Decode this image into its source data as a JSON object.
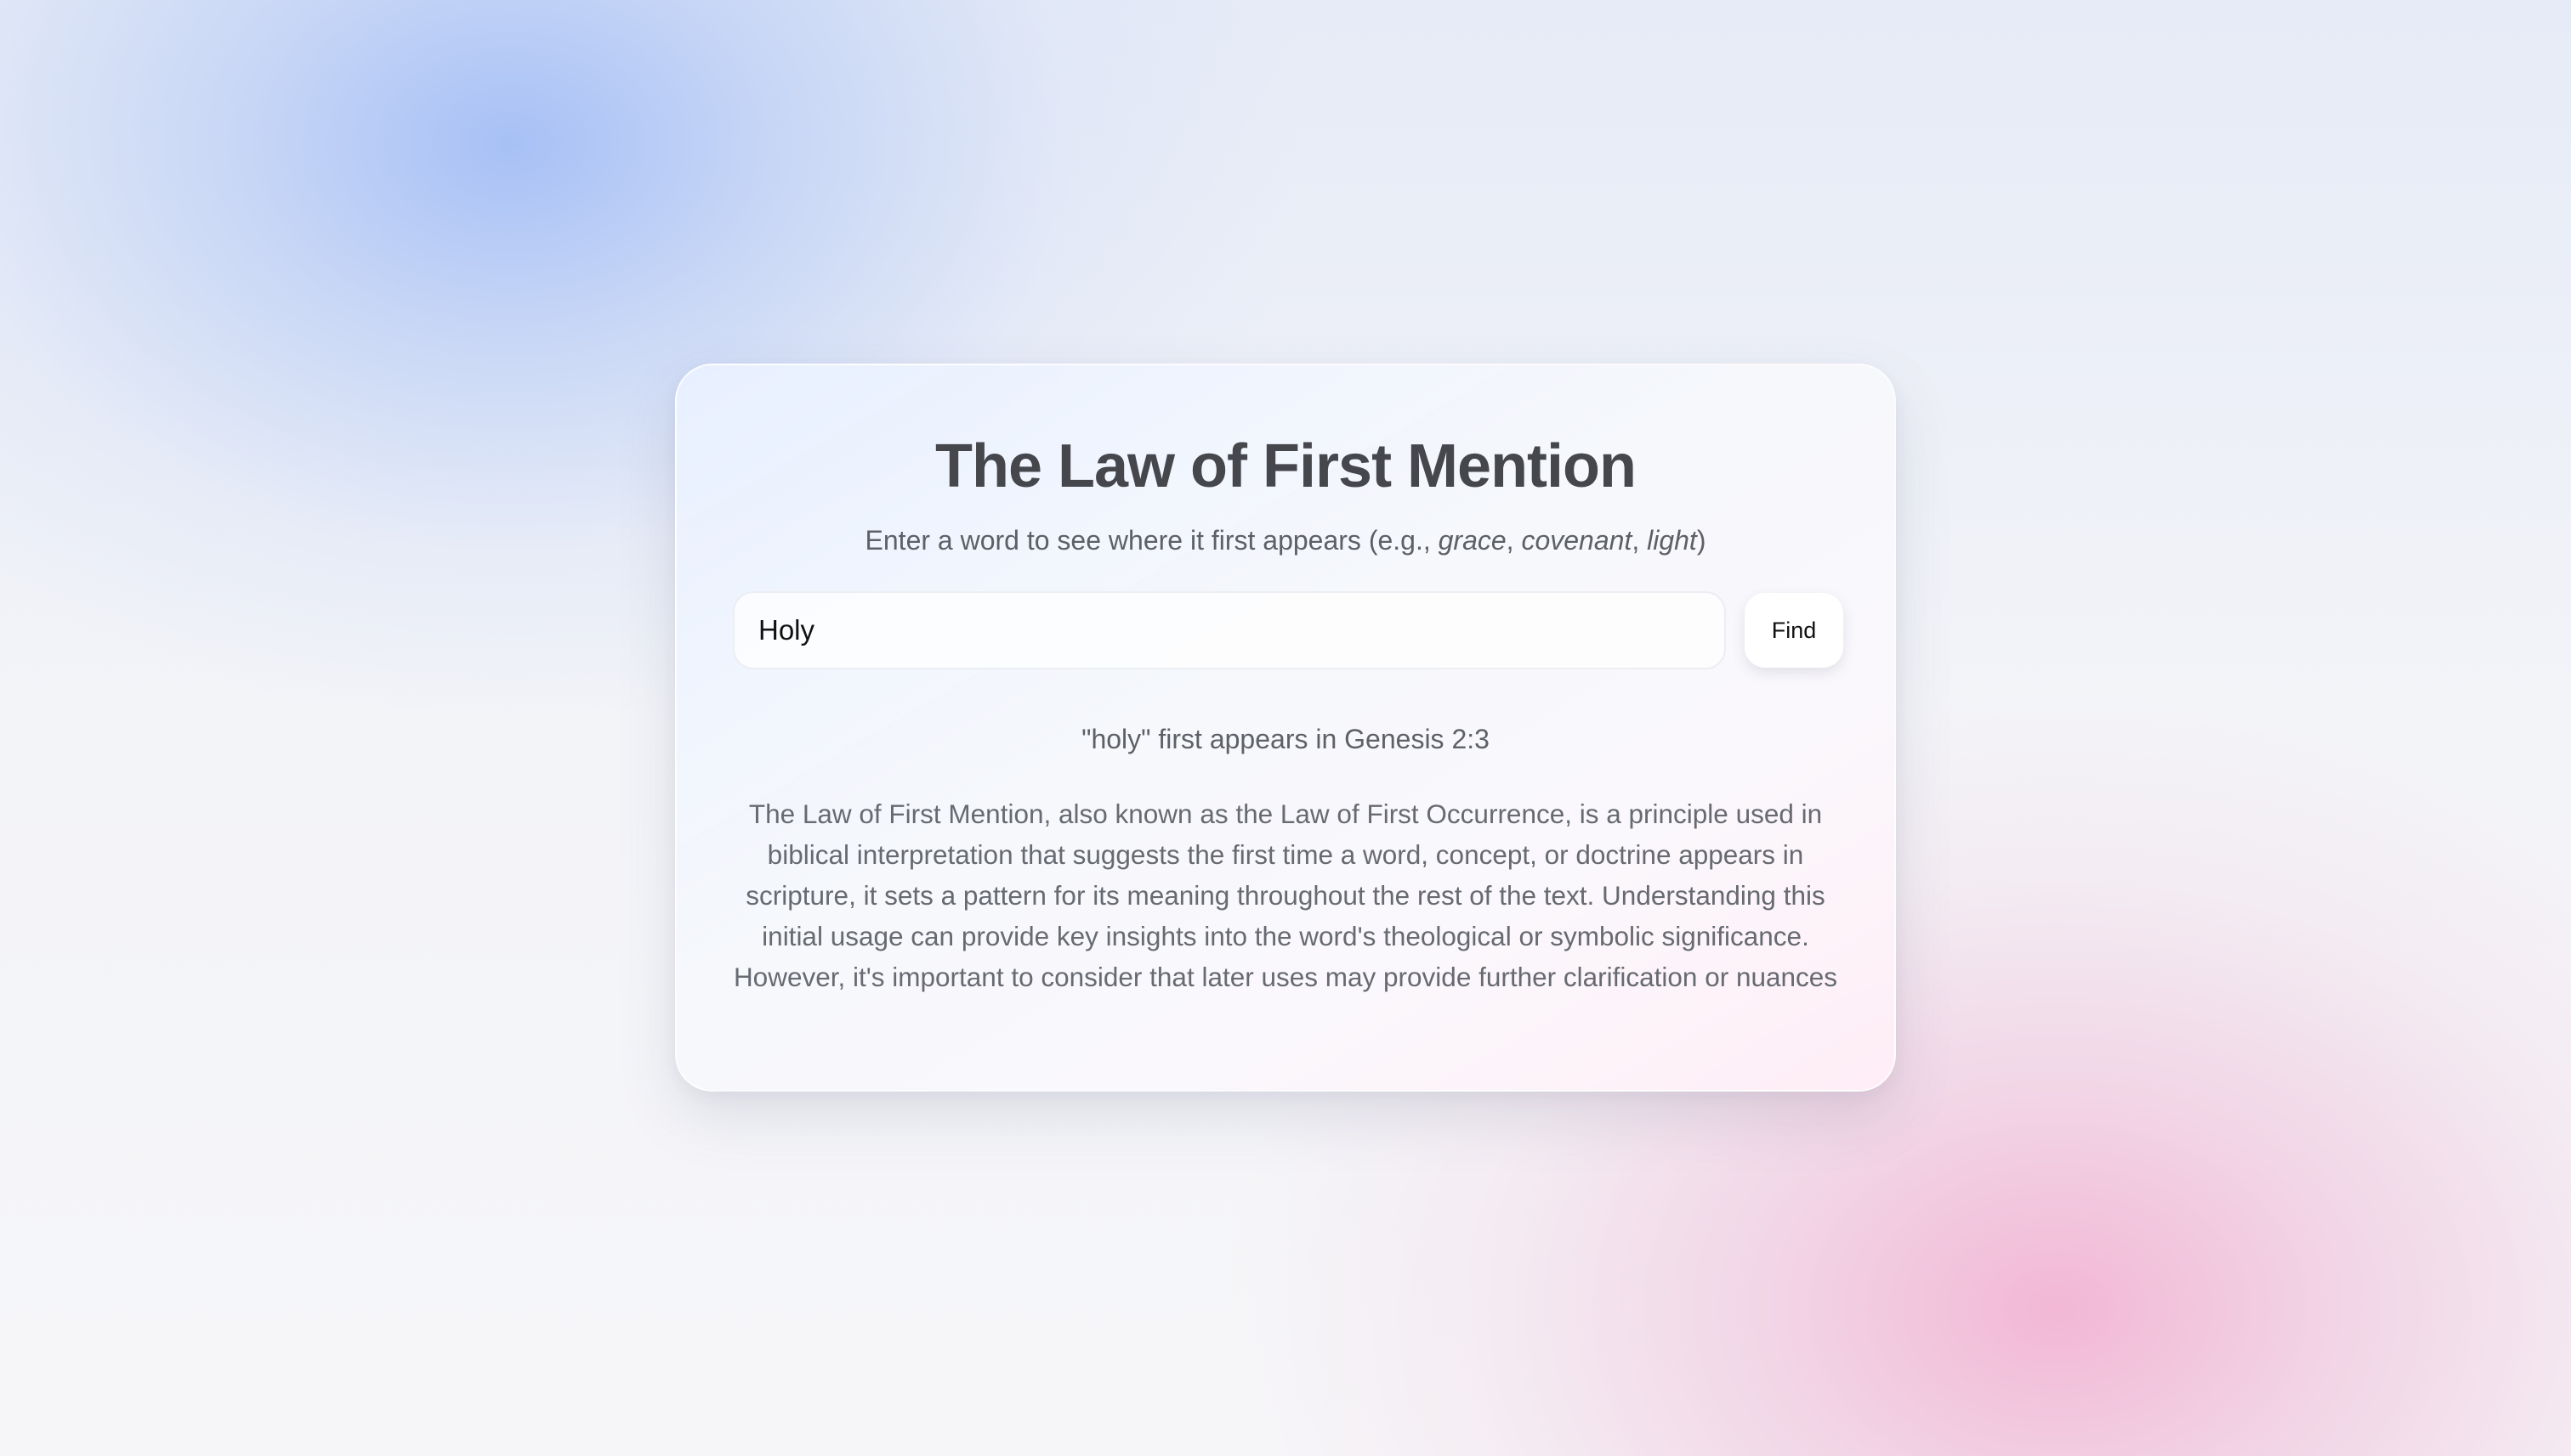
{
  "app": {
    "title": "The Law of First Mention",
    "subtitle_prefix": "Enter a word to see where it first appears (e.g., ",
    "examples": [
      "grace",
      "covenant",
      "light"
    ],
    "example_separator": ", ",
    "subtitle_suffix": ")"
  },
  "search": {
    "value": "Holy",
    "button_label": "Find"
  },
  "result": {
    "text": "\"holy\" first appears in Genesis 2:3"
  },
  "explanation": {
    "text": "The Law of First Mention, also known as the Law of First Occurrence, is a principle used in biblical interpretation that suggests the first time a word, concept, or doctrine appears in scripture, it sets a pattern for its meaning throughout the rest of the text. Understanding this initial usage can provide key insights into the word's theological or symbolic significance. However, it's important to consider that later uses may provide further clarification or nuances"
  },
  "colors": {
    "title": "#45474c",
    "body_text": "#5d6067",
    "accent_blue": "#a8c0f4",
    "accent_pink": "#f0b4d2"
  }
}
